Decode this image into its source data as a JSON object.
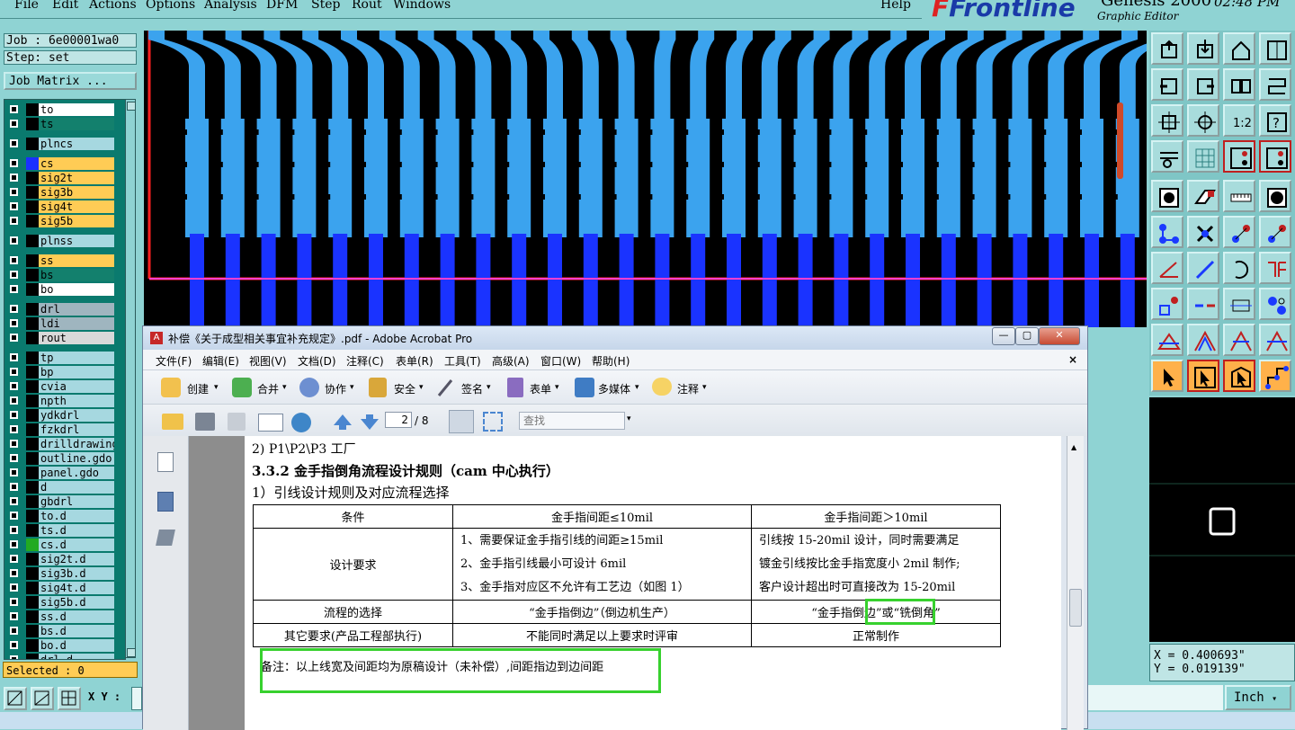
{
  "frontline": {
    "menu": [
      "File",
      "Edit",
      "Actions",
      "Options",
      "Analysis",
      "DFM",
      "Step",
      "Rout",
      "Windows"
    ],
    "help": "Help",
    "logo": "Frontline",
    "product": "Genesis 2000",
    "subtitle": "Graphic Editor",
    "clock": "02:48 PM"
  },
  "job": {
    "label": "Job : 6e00001wa0",
    "step": "Step: set",
    "matrix_button": "Job Matrix ..."
  },
  "layers": [
    {
      "name": "to",
      "color": "#ffffff",
      "swatch": "#000000"
    },
    {
      "name": "ts",
      "color": "#13806d",
      "swatch": "#000000"
    },
    {
      "name": "plncs",
      "color": "#a6d8e0",
      "swatch": "#000000"
    },
    {
      "name": "cs",
      "color": "#ffcc55",
      "swatch": "#1a30ff"
    },
    {
      "name": "sig2t",
      "color": "#ffcc55",
      "swatch": "#000000"
    },
    {
      "name": "sig3b",
      "color": "#ffcc55",
      "swatch": "#000000"
    },
    {
      "name": "sig4t",
      "color": "#ffcc55",
      "swatch": "#000000"
    },
    {
      "name": "sig5b",
      "color": "#ffcc55",
      "swatch": "#000000"
    },
    {
      "name": "plnss",
      "color": "#a6d8e0",
      "swatch": "#000000"
    },
    {
      "name": "ss",
      "color": "#ffcc55",
      "swatch": "#000000"
    },
    {
      "name": "bs",
      "color": "#13806d",
      "swatch": "#000000"
    },
    {
      "name": "bo",
      "color": "#ffffff",
      "swatch": "#000000"
    },
    {
      "name": "drl",
      "color": "#9fb5bf",
      "swatch": "#000000"
    },
    {
      "name": "ldi",
      "color": "#9fb5bf",
      "swatch": "#000000"
    },
    {
      "name": "rout",
      "color": "#d9d9d9",
      "swatch": "#000000"
    },
    {
      "name": "tp",
      "color": "#a6d8e0",
      "swatch": "#000000"
    },
    {
      "name": "bp",
      "color": "#a6d8e0",
      "swatch": "#000000"
    },
    {
      "name": "cvia",
      "color": "#a6d8e0",
      "swatch": "#000000"
    },
    {
      "name": "npth",
      "color": "#a6d8e0",
      "swatch": "#000000"
    },
    {
      "name": "ydkdrl",
      "color": "#a6d8e0",
      "swatch": "#000000"
    },
    {
      "name": "fzkdrl",
      "color": "#a6d8e0",
      "swatch": "#000000"
    },
    {
      "name": "drilldrawing",
      "color": "#a6d8e0",
      "swatch": "#000000"
    },
    {
      "name": "outline.gdo",
      "color": "#a6d8e0",
      "swatch": "#000000"
    },
    {
      "name": "panel.gdo",
      "color": "#a6d8e0",
      "swatch": "#000000"
    },
    {
      "name": "d",
      "color": "#a6d8e0",
      "swatch": "#000000"
    },
    {
      "name": "gbdrl",
      "color": "#a6d8e0",
      "swatch": "#000000"
    },
    {
      "name": "to.d",
      "color": "#a6d8e0",
      "swatch": "#000000"
    },
    {
      "name": "ts.d",
      "color": "#a6d8e0",
      "swatch": "#000000"
    },
    {
      "name": "cs.d",
      "color": "#a6d8e0",
      "swatch": "#22aa22"
    },
    {
      "name": "sig2t.d",
      "color": "#a6d8e0",
      "swatch": "#000000"
    },
    {
      "name": "sig3b.d",
      "color": "#a6d8e0",
      "swatch": "#000000"
    },
    {
      "name": "sig4t.d",
      "color": "#a6d8e0",
      "swatch": "#000000"
    },
    {
      "name": "sig5b.d",
      "color": "#a6d8e0",
      "swatch": "#000000"
    },
    {
      "name": "ss.d",
      "color": "#a6d8e0",
      "swatch": "#000000"
    },
    {
      "name": "bs.d",
      "color": "#a6d8e0",
      "swatch": "#000000"
    },
    {
      "name": "bo.d",
      "color": "#a6d8e0",
      "swatch": "#000000"
    },
    {
      "name": "drl.d",
      "color": "#a6d8e0",
      "swatch": "#000000"
    }
  ],
  "selected": "Selected : 0",
  "xy_label": "X Y :",
  "coords": {
    "x": "X = 0.400693\"",
    "y": "Y = 0.019139\""
  },
  "unit": "Inch",
  "acrobat": {
    "title": "补偿《关于成型相关事宜补充规定》.pdf - Adobe Acrobat Pro",
    "menu": [
      "文件(F)",
      "编辑(E)",
      "视图(V)",
      "文档(D)",
      "注释(C)",
      "表单(R)",
      "工具(T)",
      "高级(A)",
      "窗口(W)",
      "帮助(H)"
    ],
    "toolbar": [
      "创建",
      "合并",
      "协作",
      "安全",
      "签名",
      "表单",
      "多媒体",
      "注释"
    ],
    "page_current": "2",
    "page_total": "/ 8",
    "search_placeholder": "查找"
  },
  "doc": {
    "line1": "2) P1\\P2\\P3 工厂",
    "heading": "3.3.2  金手指倒角流程设计规则（cam 中心执行）",
    "sub": "1）引线设计规则及对应流程选择",
    "table": {
      "headers": [
        "条件",
        "金手指间距≤10mil",
        "金手指间距＞10mil"
      ],
      "row1_label": "设计要求",
      "row1_mid": [
        "1、需要保证金手指引线的间距≥15mil",
        "2、金手指引线最小可设计 6mil",
        "3、金手指对应区不允许有工艺边（如图 1）"
      ],
      "row1_right": [
        "引线按 15-20mil 设计，同时需要满足",
        "镀金引线按比金手指宽度小  2mil 制作;",
        "客户设计超出时可直接改为 15-20mil"
      ],
      "row2_label": "流程的选择",
      "row2_mid": "“金手指倒边”（倒边机生产）",
      "row2_right_a": "“金手指倒边”或",
      "row2_right_b": "“铣倒角”",
      "row3_label": "其它要求(产品工程部执行)",
      "row3_mid": "不能同时满足以上要求时评审",
      "row3_right": "正常制作"
    },
    "note": "备注：以上线宽及间距均为原稿设计（未补偿）,间距指边到边间距"
  }
}
